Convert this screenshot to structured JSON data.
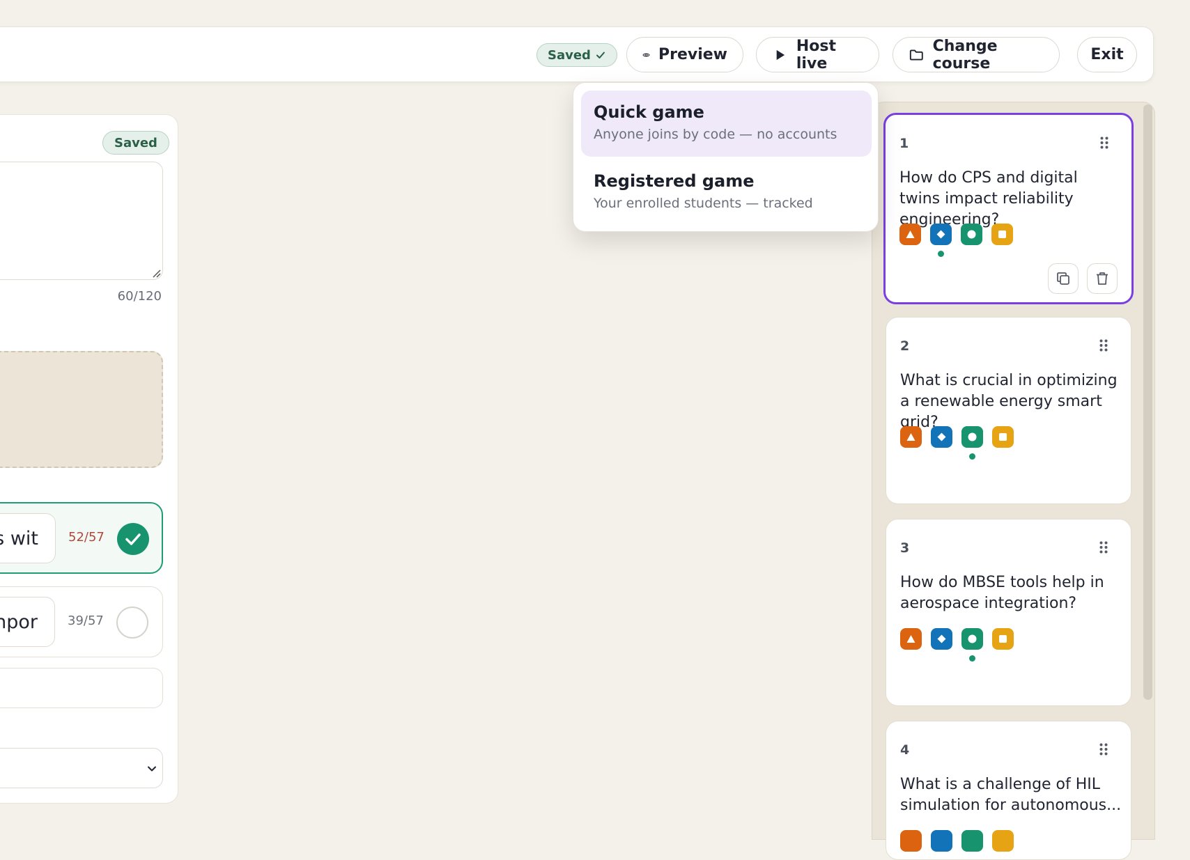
{
  "header": {
    "saved_label": "Saved",
    "buttons": {
      "preview": "Preview",
      "host_live": "Host live",
      "change_course": "Change course",
      "exit": "Exit"
    }
  },
  "editor": {
    "saved_label": "Saved",
    "char_count": "60/120",
    "answers": [
      {
        "text_visible": "s wit",
        "count": "52/57",
        "correct": true
      },
      {
        "text_visible": "npor",
        "count": "39/57",
        "correct": false
      }
    ]
  },
  "host_menu": {
    "items": [
      {
        "title": "Quick game",
        "subtitle": "Anyone joins by code — no accounts"
      },
      {
        "title": "Registered game",
        "subtitle": "Your enrolled students — tracked"
      }
    ]
  },
  "questions": [
    {
      "number": "1",
      "text": "How do CPS and digital twins impact reliability engineering?",
      "correct_shape": "diamond"
    },
    {
      "number": "2",
      "text": "What is crucial in optimizing a renewable energy smart grid?",
      "correct_shape": "circle"
    },
    {
      "number": "3",
      "text": "How do MBSE tools help in aerospace integration?",
      "correct_shape": "circle"
    },
    {
      "number": "4",
      "text": "What is a challenge of HIL simulation for autonomous...",
      "correct_shape": ""
    }
  ],
  "colors": {
    "triangle": "#dc6410",
    "diamond": "#1273b8",
    "circle": "#17946d",
    "square": "#e6a414",
    "selected_border": "#7a3fe0",
    "menu_highlight": "#f0e9fa"
  }
}
